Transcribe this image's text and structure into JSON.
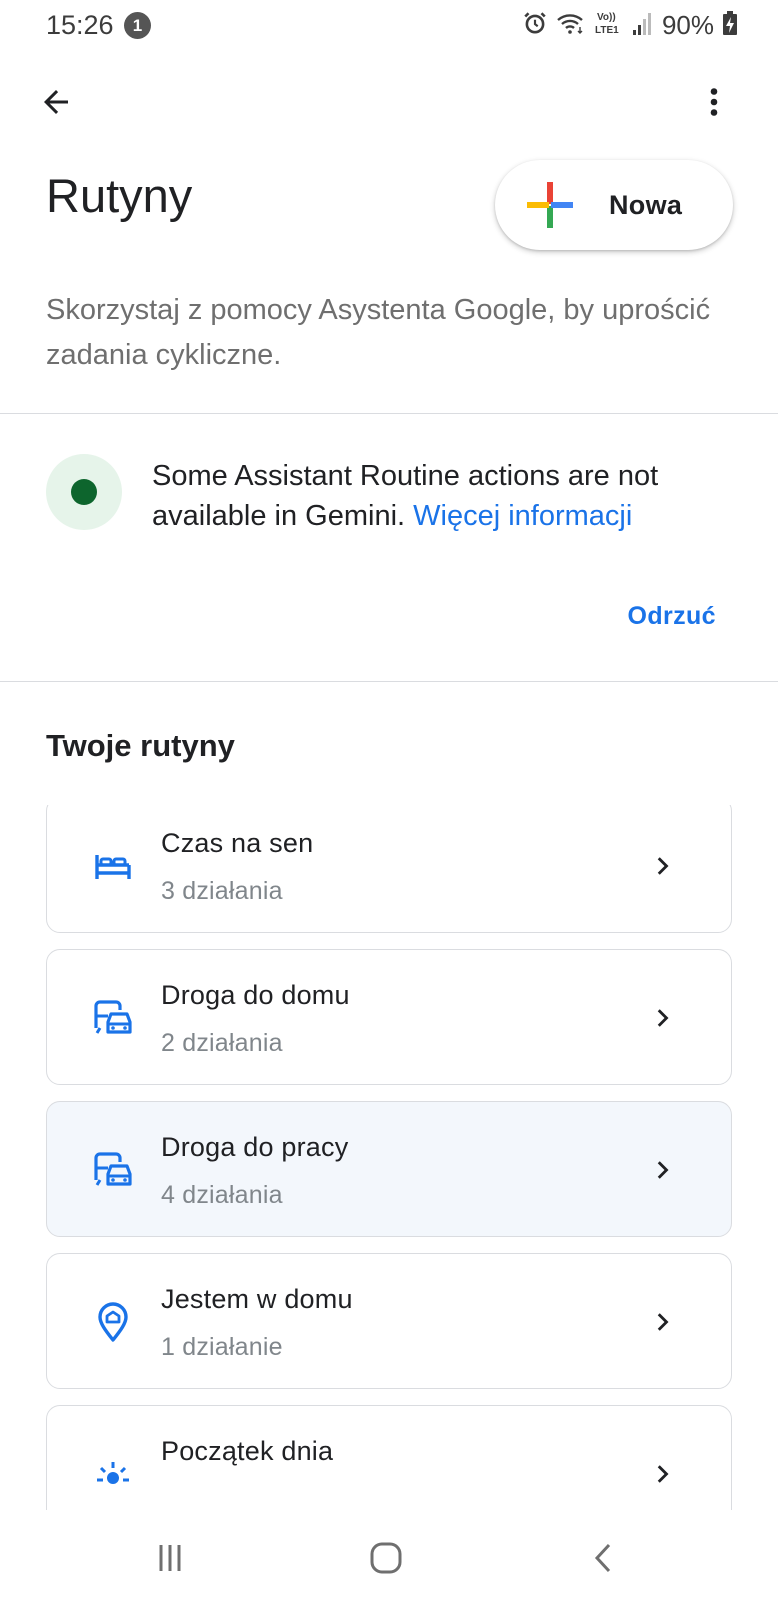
{
  "status_bar": {
    "time": "15:26",
    "notification_count": "1",
    "battery_percent": "90%",
    "icons": [
      "alarm-icon",
      "wifi-icon",
      "volte-lte-icon",
      "signal-icon",
      "battery-charging-icon"
    ]
  },
  "app_bar": {
    "back_icon": "arrow-back-icon",
    "more_icon": "more-vert-icon"
  },
  "header": {
    "title": "Rutyny",
    "new_button_label": "Nowa",
    "subtitle": "Skorzystaj z pomocy Asystenta Google, by uprościć zadania cykliczne."
  },
  "banner": {
    "text": "Some Assistant Routine actions are not available in Gemini.",
    "link_text": "Więcej informacji",
    "dismiss_label": "Odrzuć",
    "colors": {
      "icon_bg": "#e6f4ea",
      "dot": "#0d652d",
      "link": "#1a73e8"
    }
  },
  "routines": {
    "section_title": "Twoje rutyny",
    "items": [
      {
        "title": "Czas na sen",
        "subtitle": "3 działania",
        "icon": "bed-icon"
      },
      {
        "title": "Droga do domu",
        "subtitle": "2 działania",
        "icon": "commute-icon"
      },
      {
        "title": "Droga do pracy",
        "subtitle": "4 działania",
        "icon": "commute-icon",
        "highlighted": true
      },
      {
        "title": "Jestem w domu",
        "subtitle": "1 działanie",
        "icon": "home-pin-icon"
      },
      {
        "title": "Początek dnia",
        "subtitle": "",
        "icon": "sunrise-icon"
      }
    ]
  },
  "nav_bar": {
    "icons": [
      "recent-apps-icon",
      "home-icon",
      "back-icon"
    ]
  },
  "colors": {
    "accent": "#1a73e8",
    "icon_blue": "#1a73e8",
    "card_border": "#dadce0",
    "highlight_bg": "#f3f7fc"
  }
}
